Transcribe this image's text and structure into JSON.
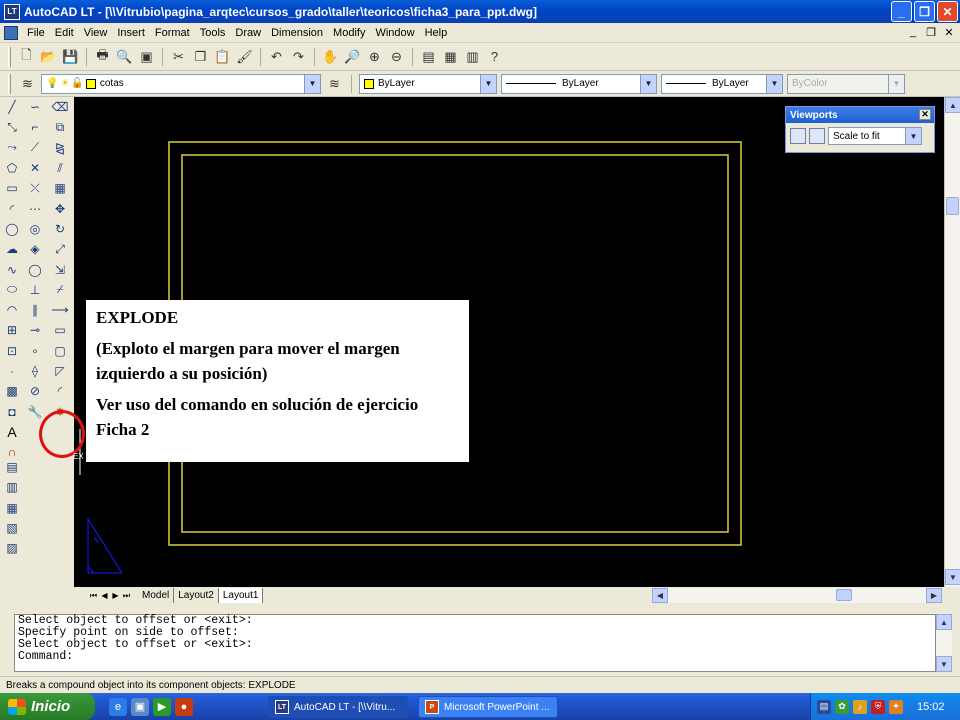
{
  "window": {
    "title": "AutoCAD LT - [\\\\Vitrubio\\pagina_arqtec\\cursos_grado\\taller\\teoricos\\ficha3_para_ppt.dwg]",
    "app_badge": "LT",
    "controls": [
      "_",
      "❐",
      "✕"
    ]
  },
  "menu": {
    "items": [
      "File",
      "Edit",
      "View",
      "Insert",
      "Format",
      "Tools",
      "Draw",
      "Dimension",
      "Modify",
      "Window",
      "Help"
    ],
    "mdi_controls": [
      "_",
      "❐",
      "✕"
    ]
  },
  "toolbar": {
    "standard": [
      "new-icon",
      "open-icon",
      "save-icon",
      "print-icon",
      "preview-icon",
      "cut-icon",
      "copy-icon",
      "paste-icon",
      "match-icon",
      "undo-icon",
      "redo-icon",
      "pan-icon",
      "zoom-realtime-icon",
      "zoom-window-icon",
      "zoom-previous-icon",
      "properties-icon",
      "designcenter-icon",
      "toolpalette-icon",
      "help-icon"
    ]
  },
  "properties_bar": {
    "layer": "cotas",
    "color": "ByLayer",
    "linetype": "ByLayer",
    "lineweight": "ByLayer",
    "plotstyle": "ByColor",
    "layer_color": "#ffff00"
  },
  "draw_tools": [
    "line",
    "construction-line",
    "polyline",
    "polygon",
    "rectangle",
    "arc",
    "circle",
    "revision-cloud",
    "spline",
    "ellipse",
    "ellipse-arc",
    "insert-block",
    "make-block",
    "point",
    "hatch",
    "region",
    "mtext"
  ],
  "modify_tools": [
    "erase",
    "copy",
    "mirror",
    "offset",
    "array",
    "move",
    "rotate",
    "scale",
    "stretch",
    "trim",
    "extend",
    "break",
    "join",
    "chamfer",
    "fillet",
    "explode"
  ],
  "viewports": {
    "title": "Viewports",
    "scale": "Scale to fit"
  },
  "callout": {
    "heading": "EXPLODE",
    "line1": "(Exploto el margen para mover el margen izquierdo a su posición)",
    "line2": "Ver uso del comando en solución de ejercicio Ficha 2"
  },
  "cursor_tooltip": "EX",
  "layout_tabs": [
    "Model",
    "Layout2",
    "Layout1"
  ],
  "active_tab": "Layout1",
  "command_history": [
    "Select object to offset or <exit>:",
    "Specify point on side to offset:",
    "Select object to offset or <exit>:",
    "Command:"
  ],
  "status_text": "Breaks a compound object into its component objects:  EXPLODE",
  "taskbar": {
    "start_label": "Inicio",
    "tasks": [
      {
        "label": "AutoCAD LT - [\\\\Vitru...",
        "icon": "LT"
      },
      {
        "label": "Microsoft PowerPoint ...",
        "icon": "P"
      }
    ],
    "clock": "15:02"
  },
  "colors": {
    "canvas": "#000000",
    "margin_lines": "#d8d040",
    "ucs_icon": "#1a1aff",
    "highlight": "#e01010"
  }
}
